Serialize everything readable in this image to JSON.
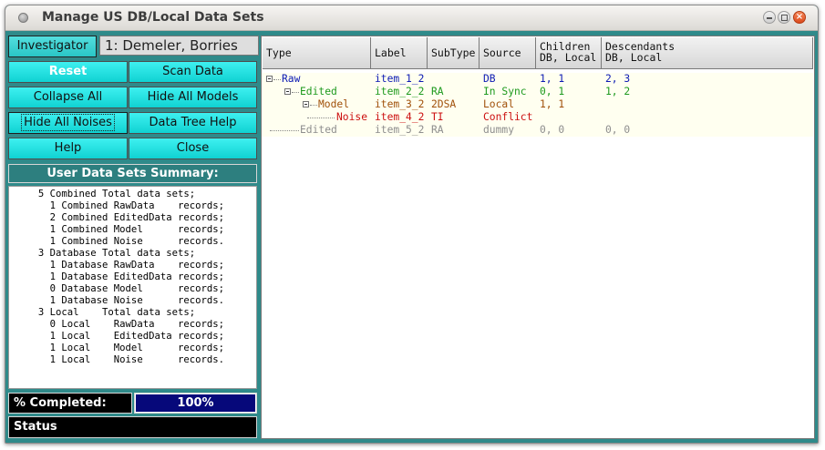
{
  "window": {
    "title": "Manage US DB/Local Data Sets"
  },
  "investigator": {
    "button_label": "Investigator",
    "value": "1: Demeler, Borries"
  },
  "buttons": {
    "reset": "Reset",
    "scan_data": "Scan Data",
    "collapse_all": "Collapse All",
    "hide_all_models": "Hide All Models",
    "hide_all_noises": "Hide All Noises",
    "data_tree_help": "Data Tree Help",
    "help": "Help",
    "close": "Close"
  },
  "summary": {
    "title": "User Data Sets Summary:",
    "lines": [
      "     5 Combined Total data sets;",
      "       1 Combined RawData    records;",
      "       2 Combined EditedData records;",
      "       1 Combined Model      records;",
      "       1 Combined Noise      records.",
      "     3 Database Total data sets;",
      "       1 Database RawData    records;",
      "       1 Database EditedData records;",
      "       0 Database Model      records;",
      "       1 Database Noise      records.",
      "     3 Local    Total data sets;",
      "       0 Local    RawData    records;",
      "       1 Local    EditedData records;",
      "       1 Local    Model      records;",
      "       1 Local    Noise      records."
    ]
  },
  "progress": {
    "label": "% Completed:",
    "value": 100,
    "text": "100%"
  },
  "status": {
    "label": "Status"
  },
  "tree": {
    "columns": [
      {
        "line1": "Type",
        "line2": ""
      },
      {
        "line1": "Label",
        "line2": ""
      },
      {
        "line1": "SubType",
        "line2": ""
      },
      {
        "line1": "Source",
        "line2": ""
      },
      {
        "line1": "Children",
        "line2": "DB, Local"
      },
      {
        "line1": "Descendants",
        "line2": "DB, Local"
      }
    ],
    "rows": [
      {
        "type": "Raw",
        "label": "item_1_2",
        "subtype": "",
        "source": "DB",
        "children": "1, 1",
        "descendants": "2, 3"
      },
      {
        "type": "Edited",
        "label": "item_2_2",
        "subtype": "RA",
        "source": "In Sync",
        "children": "0, 1",
        "descendants": "1, 2"
      },
      {
        "type": "Model",
        "label": "item_3_2",
        "subtype": "2DSA",
        "source": "Local",
        "children": "1, 1",
        "descendants": ""
      },
      {
        "type": "Noise",
        "label": "item_4_2",
        "subtype": "TI",
        "source": "Conflict",
        "children": "",
        "descendants": ""
      },
      {
        "type": "Edited",
        "label": "item_5_2",
        "subtype": "RA",
        "source": "dummy",
        "children": "0, 0",
        "descendants": "0, 0"
      }
    ]
  },
  "colors": {
    "accent_cyan": "#1ce0e0",
    "panel_teal": "#2f8a8a",
    "progress_fill": "#06087a",
    "raw": "#0d1bb4",
    "edited": "#1e9a1e",
    "model": "#a0500a",
    "noise": "#cc1010",
    "dummy": "#8e8e8e"
  }
}
